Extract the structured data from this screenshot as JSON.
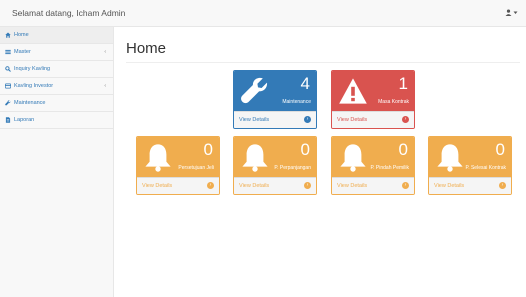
{
  "header": {
    "brand": "Selamat datang, Icham Admin",
    "user_icon": "user-icon"
  },
  "sidebar": {
    "items": [
      {
        "label": "Home",
        "icon": "home-icon"
      },
      {
        "label": "Master",
        "icon": "list-icon",
        "has_submenu": true
      },
      {
        "label": "Inquiry Kavling",
        "icon": "search-icon"
      },
      {
        "label": "Kavling Investor",
        "icon": "card-icon",
        "has_submenu": true
      },
      {
        "label": "Maintenance",
        "icon": "wrench-icon"
      },
      {
        "label": "Laporan",
        "icon": "file-icon"
      }
    ]
  },
  "main": {
    "title": "Home",
    "panels": [
      {
        "count": "4",
        "label": "Maintenance",
        "footer": "View Details",
        "color": "#337ab7",
        "icon": "wrench-icon"
      },
      {
        "count": "1",
        "label": "Masa Kontrak",
        "footer": "View Details",
        "color": "#d9534f",
        "icon": "warning-icon"
      },
      {
        "count": "0",
        "label": "Persetujuan Jeli",
        "footer": "View Details",
        "color": "#f0ad4e",
        "icon": "bell-icon"
      },
      {
        "count": "0",
        "label": "P. Perpanjangan",
        "footer": "View Details",
        "color": "#f0ad4e",
        "icon": "bell-icon"
      },
      {
        "count": "0",
        "label": "P. Pindah Pemilik",
        "footer": "View Details",
        "color": "#f0ad4e",
        "icon": "bell-icon"
      },
      {
        "count": "0",
        "label": "P. Selesai Kontrak",
        "footer": "View Details",
        "color": "#f0ad4e",
        "icon": "bell-icon"
      }
    ]
  }
}
